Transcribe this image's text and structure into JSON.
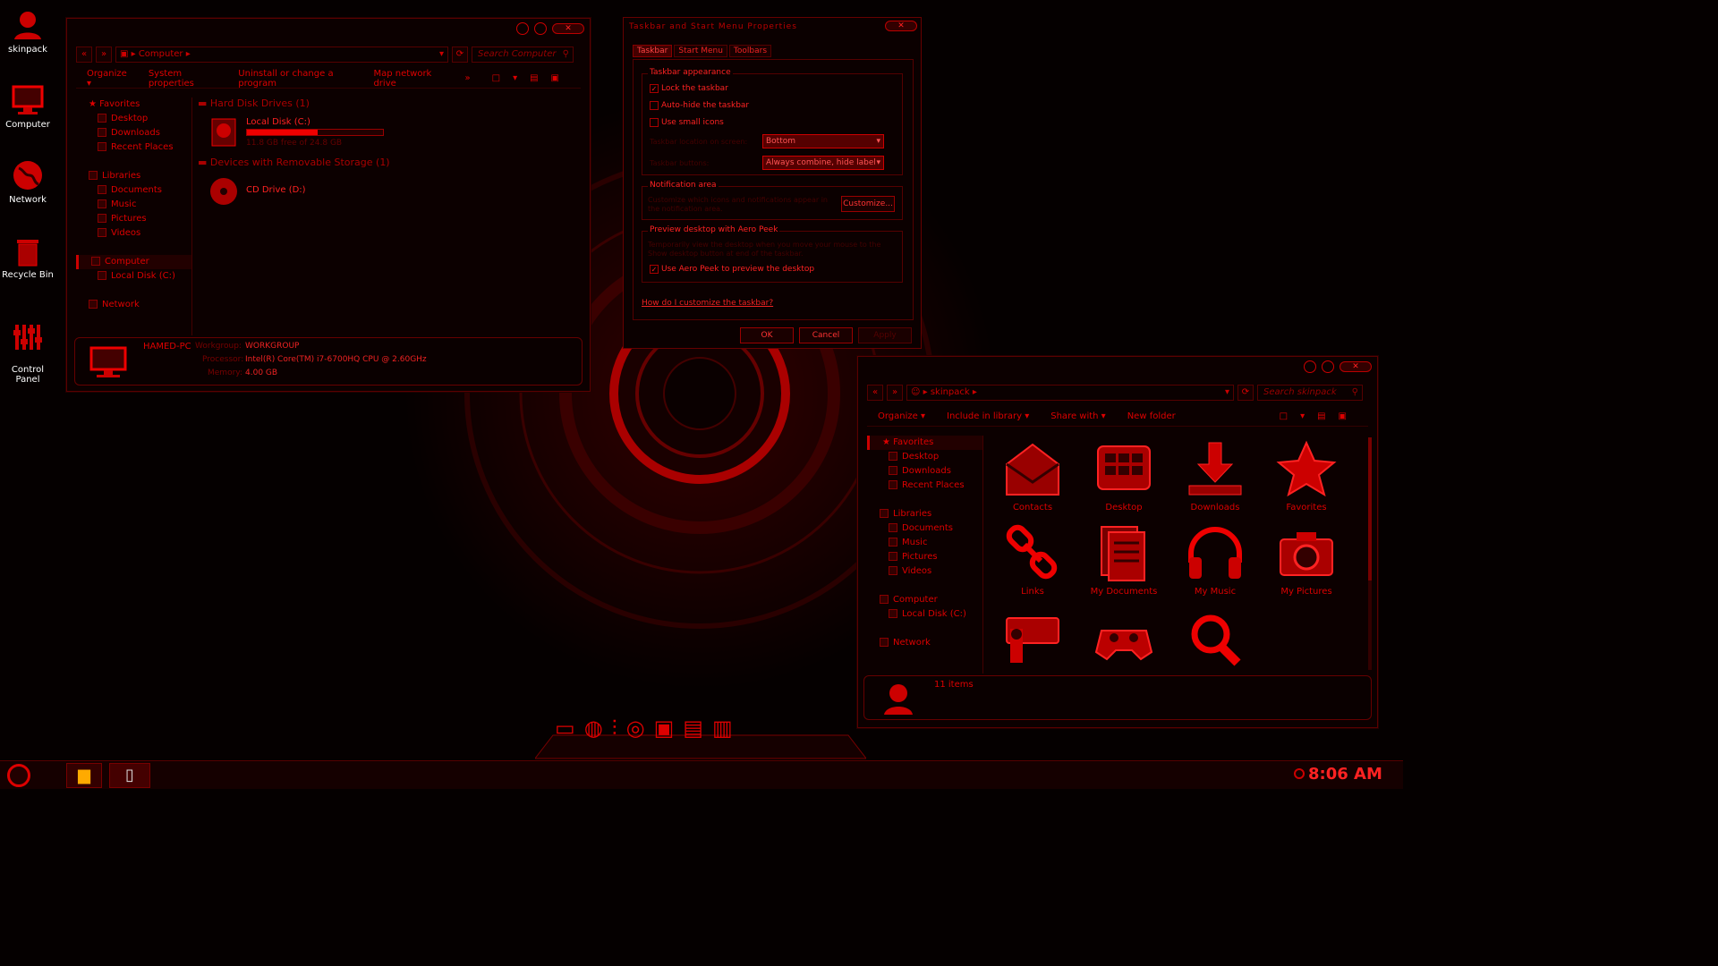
{
  "desktop": {
    "icons": [
      {
        "label": "skinpack",
        "icon": "user-icon"
      },
      {
        "label": "Computer",
        "icon": "computer-icon"
      },
      {
        "label": "Network",
        "icon": "globe-icon"
      },
      {
        "label": "Recycle Bin",
        "icon": "trash-icon"
      },
      {
        "label": "Control\nPanel",
        "icon": "sliders-icon"
      }
    ]
  },
  "computer_window": {
    "breadcrumb": "Computer",
    "search_placeholder": "Search Computer",
    "toolbar": [
      "Organize ▾",
      "System properties",
      "Uninstall or change a program",
      "Map network drive",
      "»"
    ],
    "tree": [
      "Favorites",
      "Desktop",
      "Downloads",
      "Recent Places",
      "Libraries",
      "Documents",
      "Music",
      "Pictures",
      "Videos",
      "Computer",
      "Local Disk (C:)",
      "Network"
    ],
    "groups": [
      {
        "title": "Hard Disk Drives (1)"
      },
      {
        "title": "Devices with Removable Storage (1)"
      }
    ],
    "drives": {
      "c_label": "Local Disk (C:)",
      "c_free": "11.8 GB free of 24.8 GB",
      "c_used_fraction": 0.52,
      "d_label": "CD Drive (D:)"
    },
    "details": {
      "name": "HAMED-PC",
      "workgroup_label": "Workgroup:",
      "workgroup": "WORKGROUP",
      "processor_label": "Processor:",
      "processor": "Intel(R) Core(TM) i7-6700HQ CPU @ 2.60GHz",
      "memory_label": "Memory:",
      "memory": "4.00 GB"
    }
  },
  "dialog": {
    "title": "Taskbar and Start Menu Properties",
    "tabs": [
      "Taskbar",
      "Start Menu",
      "Toolbars"
    ],
    "appearance_title": "Taskbar appearance",
    "lock": "Lock the taskbar",
    "autohide": "Auto-hide the taskbar",
    "small": "Use small icons",
    "location_label": "Taskbar location on screen:",
    "location_value": "Bottom",
    "buttons_label": "Taskbar buttons:",
    "buttons_value": "Always combine, hide labels",
    "notif_title": "Notification area",
    "notif_text": "Customize which icons and notifications appear in the notification area.",
    "customize": "Customize...",
    "peek_title": "Preview desktop with Aero Peek",
    "peek_text": "Temporarily view the desktop when you move your mouse to the Show desktop button at end of the taskbar.",
    "peek_cb": "Use Aero Peek to preview the desktop",
    "help_link": "How do I customize the taskbar?",
    "ok": "OK",
    "cancel": "Cancel",
    "apply": "Apply"
  },
  "skinpack_window": {
    "breadcrumb": "skinpack",
    "search_placeholder": "Search skinpack",
    "toolbar": [
      "Organize ▾",
      "Include in library ▾",
      "Share with ▾",
      "New folder"
    ],
    "tree": [
      "Favorites",
      "Desktop",
      "Downloads",
      "Recent Places",
      "Libraries",
      "Documents",
      "Music",
      "Pictures",
      "Videos",
      "Computer",
      "Local Disk (C:)",
      "Network"
    ],
    "items": [
      "Contacts",
      "Desktop",
      "Downloads",
      "Favorites",
      "Links",
      "My Documents",
      "My Music",
      "My Pictures",
      "",
      "",
      ""
    ],
    "status": "11 items"
  },
  "taskbar": {
    "time": "8:06 AM"
  }
}
